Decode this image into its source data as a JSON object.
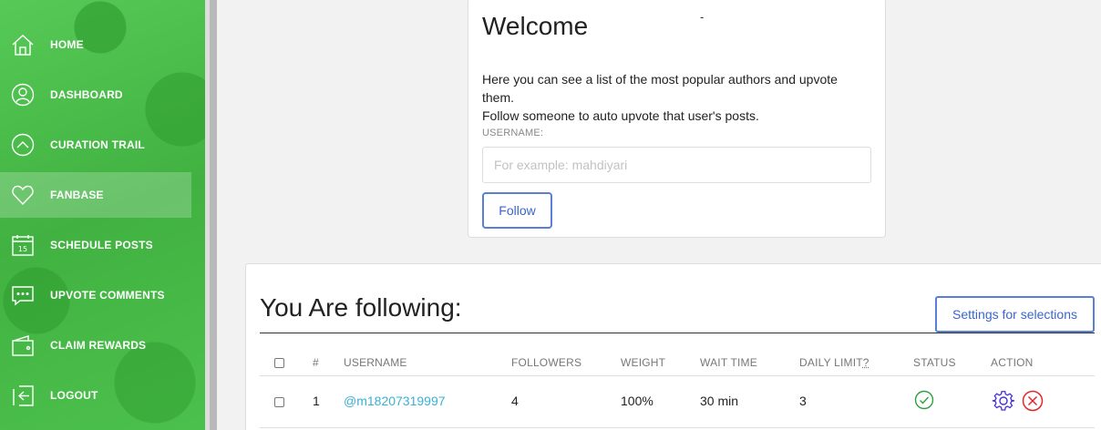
{
  "sidebar": {
    "items": [
      {
        "label": "HOME",
        "icon": "home-icon"
      },
      {
        "label": "DASHBOARD",
        "icon": "user-icon"
      },
      {
        "label": "CURATION TRAIL",
        "icon": "chevron-up-circle-icon"
      },
      {
        "label": "FANBASE",
        "icon": "heart-icon",
        "active": true
      },
      {
        "label": "SCHEDULE POSTS",
        "icon": "calendar-icon",
        "calendar_day": "15"
      },
      {
        "label": "UPVOTE COMMENTS",
        "icon": "comment-icon"
      },
      {
        "label": "CLAIM REWARDS",
        "icon": "wallet-icon"
      },
      {
        "label": "LOGOUT",
        "icon": "logout-icon"
      }
    ]
  },
  "welcome": {
    "title": "Welcome",
    "dash": "-",
    "text_line1": "Here you can see a list of the most popular authors and upvote them.",
    "text_line2": "Follow someone to auto upvote that user's posts.",
    "username_label": "USERNAME:",
    "username_placeholder": "For example: mahdiyari",
    "follow_label": "Follow"
  },
  "following": {
    "title": "You Are following:",
    "settings_label": "Settings for selections",
    "columns": {
      "index": "#",
      "username": "USERNAME",
      "followers": "FOLLOWERS",
      "weight": "WEIGHT",
      "wait_time": "WAIT TIME",
      "daily_limit": "DAILY LIMIT",
      "daily_limit_hint": "?",
      "status": "STATUS",
      "action": "ACTION"
    },
    "rows": [
      {
        "index": "1",
        "username": "@m18207319997",
        "followers": "4",
        "weight": "100%",
        "wait_time": "30 min",
        "daily_limit": "3"
      }
    ]
  },
  "colors": {
    "sidebar_green": "#4cbc4c",
    "accent_blue": "#3a66c9",
    "link_blue": "#3ab0d4",
    "status_green": "#2e9e3e",
    "gear_purple": "#3f2fd6",
    "delete_red": "#e0262b"
  }
}
